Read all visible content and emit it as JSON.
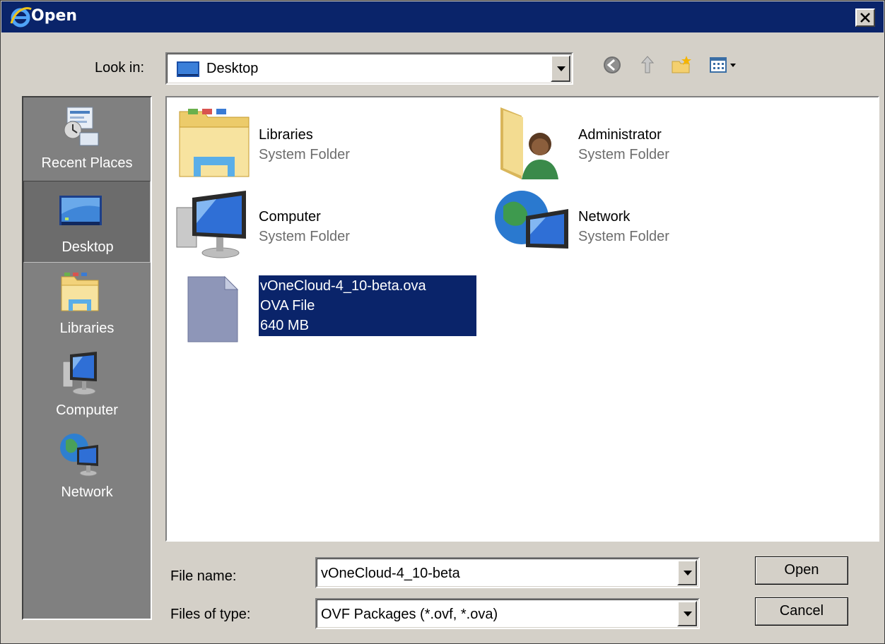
{
  "window": {
    "title": "Open",
    "icon": "ie-icon"
  },
  "look_in": {
    "label": "Look in:",
    "value": "Desktop",
    "icon": "desktop-icon"
  },
  "toolbar": {
    "icons": [
      "back-icon",
      "up-folder-icon",
      "new-folder-icon",
      "view-menu-icon"
    ]
  },
  "places": [
    {
      "label": "Recent Places",
      "icon": "recent-places-icon",
      "selected": false
    },
    {
      "label": "Desktop",
      "icon": "desktop-icon",
      "selected": true
    },
    {
      "label": "Libraries",
      "icon": "libraries-icon",
      "selected": false
    },
    {
      "label": "Computer",
      "icon": "computer-icon",
      "selected": false
    },
    {
      "label": "Network",
      "icon": "network-icon",
      "selected": false
    }
  ],
  "items": [
    {
      "name": "Libraries",
      "type": "System Folder",
      "icon": "libraries-folder-icon"
    },
    {
      "name": "Administrator",
      "type": "System Folder",
      "icon": "user-folder-icon"
    },
    {
      "name": "Computer",
      "type": "System Folder",
      "icon": "computer-icon"
    },
    {
      "name": "Network",
      "type": "System Folder",
      "icon": "network-icon"
    },
    {
      "name": "vOneCloud-4_10-beta.ova",
      "type": "OVA File",
      "size": "640 MB",
      "icon": "generic-file-icon",
      "selected": true
    }
  ],
  "file_name": {
    "label": "File name:",
    "value": "vOneCloud-4_10-beta"
  },
  "file_type": {
    "label": "Files of type:",
    "value": "OVF Packages (*.ovf, *.ova)"
  },
  "buttons": {
    "open": "Open",
    "cancel": "Cancel"
  },
  "colors": {
    "title_bar": "#0a246a",
    "dialog_bg": "#d4d0c8",
    "places_bg": "#808080",
    "selection": "#0a246a"
  }
}
